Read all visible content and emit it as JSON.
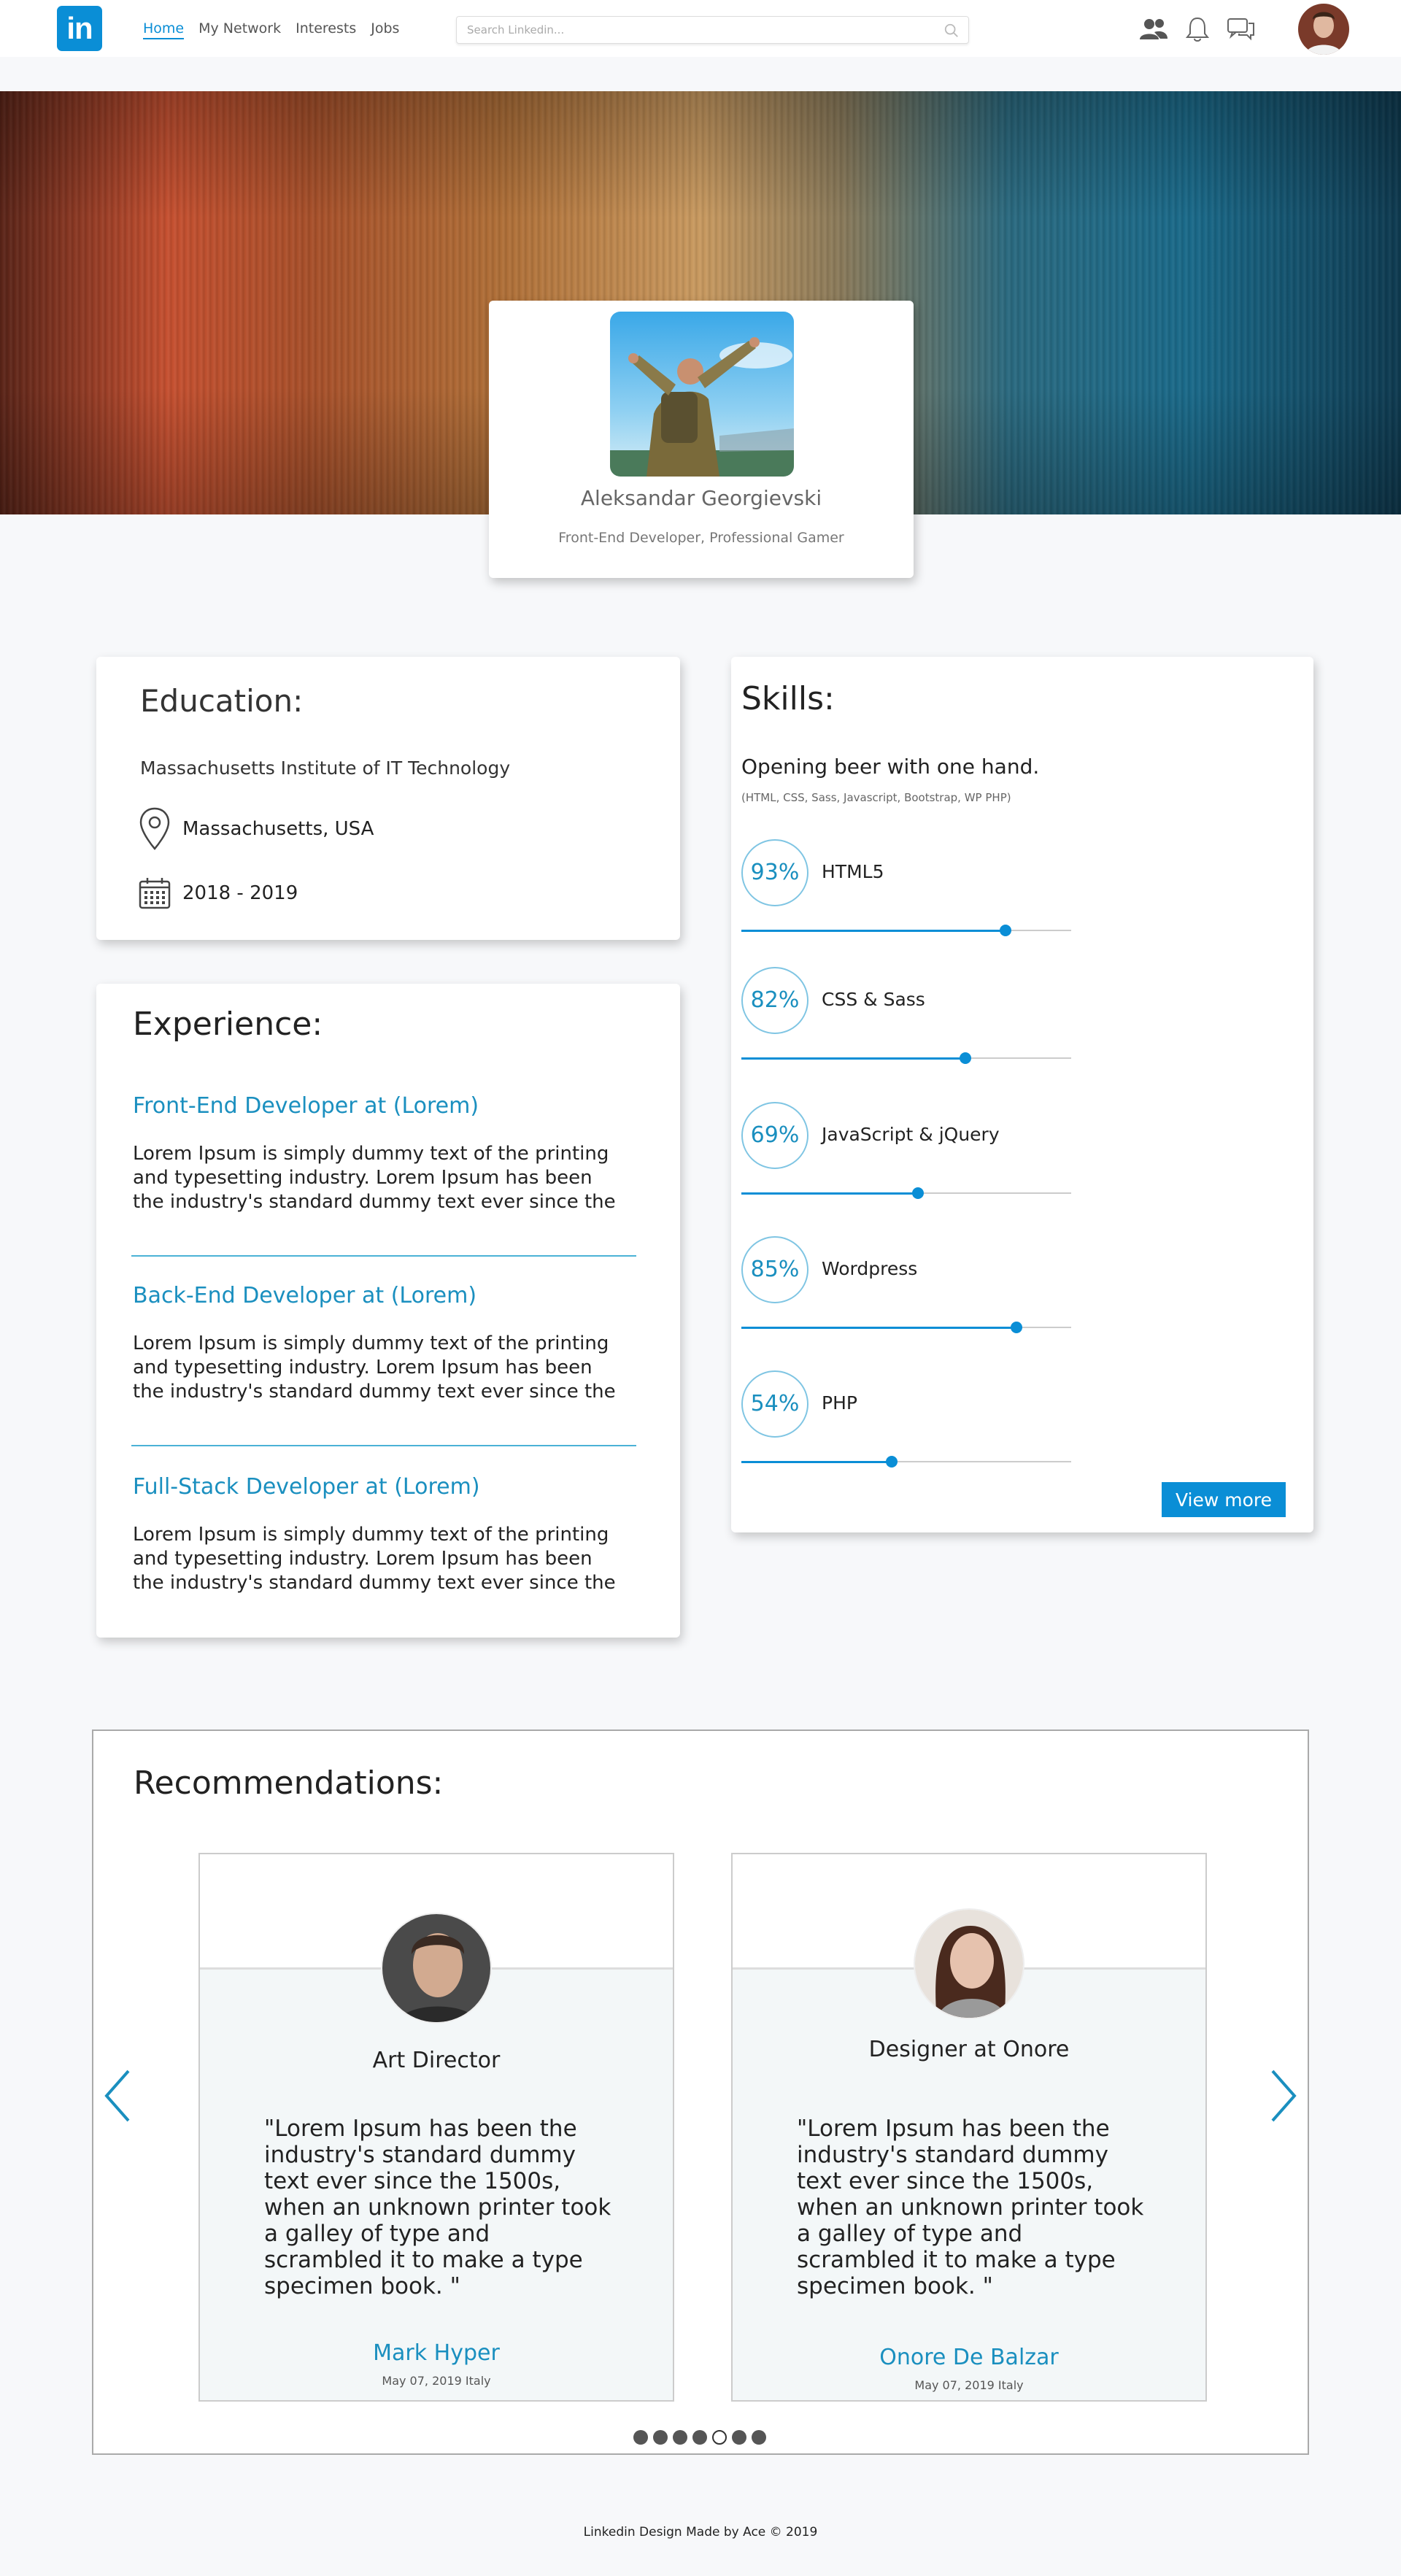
{
  "nav": {
    "logo": "in",
    "links": [
      "Home",
      "My Network",
      "Interests",
      "Jobs"
    ],
    "search_placeholder": "Search Linkedin..."
  },
  "profile": {
    "name": "Aleksandar Georgievski",
    "title": "Front-End Developer, Professional Gamer"
  },
  "education": {
    "heading": "Education:",
    "school": "Massachusetts Institute of IT Technology",
    "location": "Massachusetts, USA",
    "years": "2018 - 2019"
  },
  "experience": {
    "heading": "Experience:",
    "jobs": [
      {
        "title": "Front-End Developer at (Lorem)",
        "desc": "Lorem Ipsum is simply dummy text of the printing and typesetting industry. Lorem Ipsum has been the industry's standard dummy text ever since the"
      },
      {
        "title": "Back-End Developer at (Lorem)",
        "desc": "Lorem Ipsum is simply dummy text of the printing and typesetting industry. Lorem Ipsum has been the industry's standard dummy text ever since the"
      },
      {
        "title": "Full-Stack Developer at (Lorem)",
        "desc": "Lorem Ipsum is simply dummy text of the printing and typesetting industry. Lorem Ipsum has been the industry's standard dummy text ever since the"
      }
    ]
  },
  "skills": {
    "heading": "Skills:",
    "lead": "Opening beer with one hand.",
    "sub": "(HTML, CSS, Sass, Javascript, Bootstrap, WP PHP)",
    "items": [
      {
        "percent": "93%",
        "name": "HTML5",
        "level": 0.8
      },
      {
        "percent": "82%",
        "name": "CSS & Sass",
        "level": 0.68
      },
      {
        "percent": "69%",
        "name": "JavaScript & jQuery",
        "level": 0.535
      },
      {
        "percent": "85%",
        "name": "Wordpress",
        "level": 0.835
      },
      {
        "percent": "54%",
        "name": "PHP",
        "level": 0.455
      }
    ],
    "view_more": "View more"
  },
  "recommendations": {
    "heading": "Recommendations:",
    "items": [
      {
        "role": "Art Director",
        "quote": "\"Lorem Ipsum has been the industry's standard dummy text ever since the 1500s, when an unknown printer took a galley of type and scrambled it to make a type specimen book. \"",
        "name": "Mark Hyper",
        "date": "May 07, 2019 Italy"
      },
      {
        "role": "Designer at Onore",
        "quote": "\"Lorem Ipsum has been the industry's standard dummy text ever since the 1500s, when an unknown printer took a galley of type and scrambled it to make a type specimen book. \"",
        "name": "Onore De Balzar",
        "date": "May 07, 2019 Italy"
      }
    ],
    "dots_total": 7,
    "active_dot": 5
  },
  "footer": "Linkedin Design Made by Ace © 2019",
  "colors": {
    "accent": "#0a8ed6",
    "link": "#1a8fbf"
  }
}
